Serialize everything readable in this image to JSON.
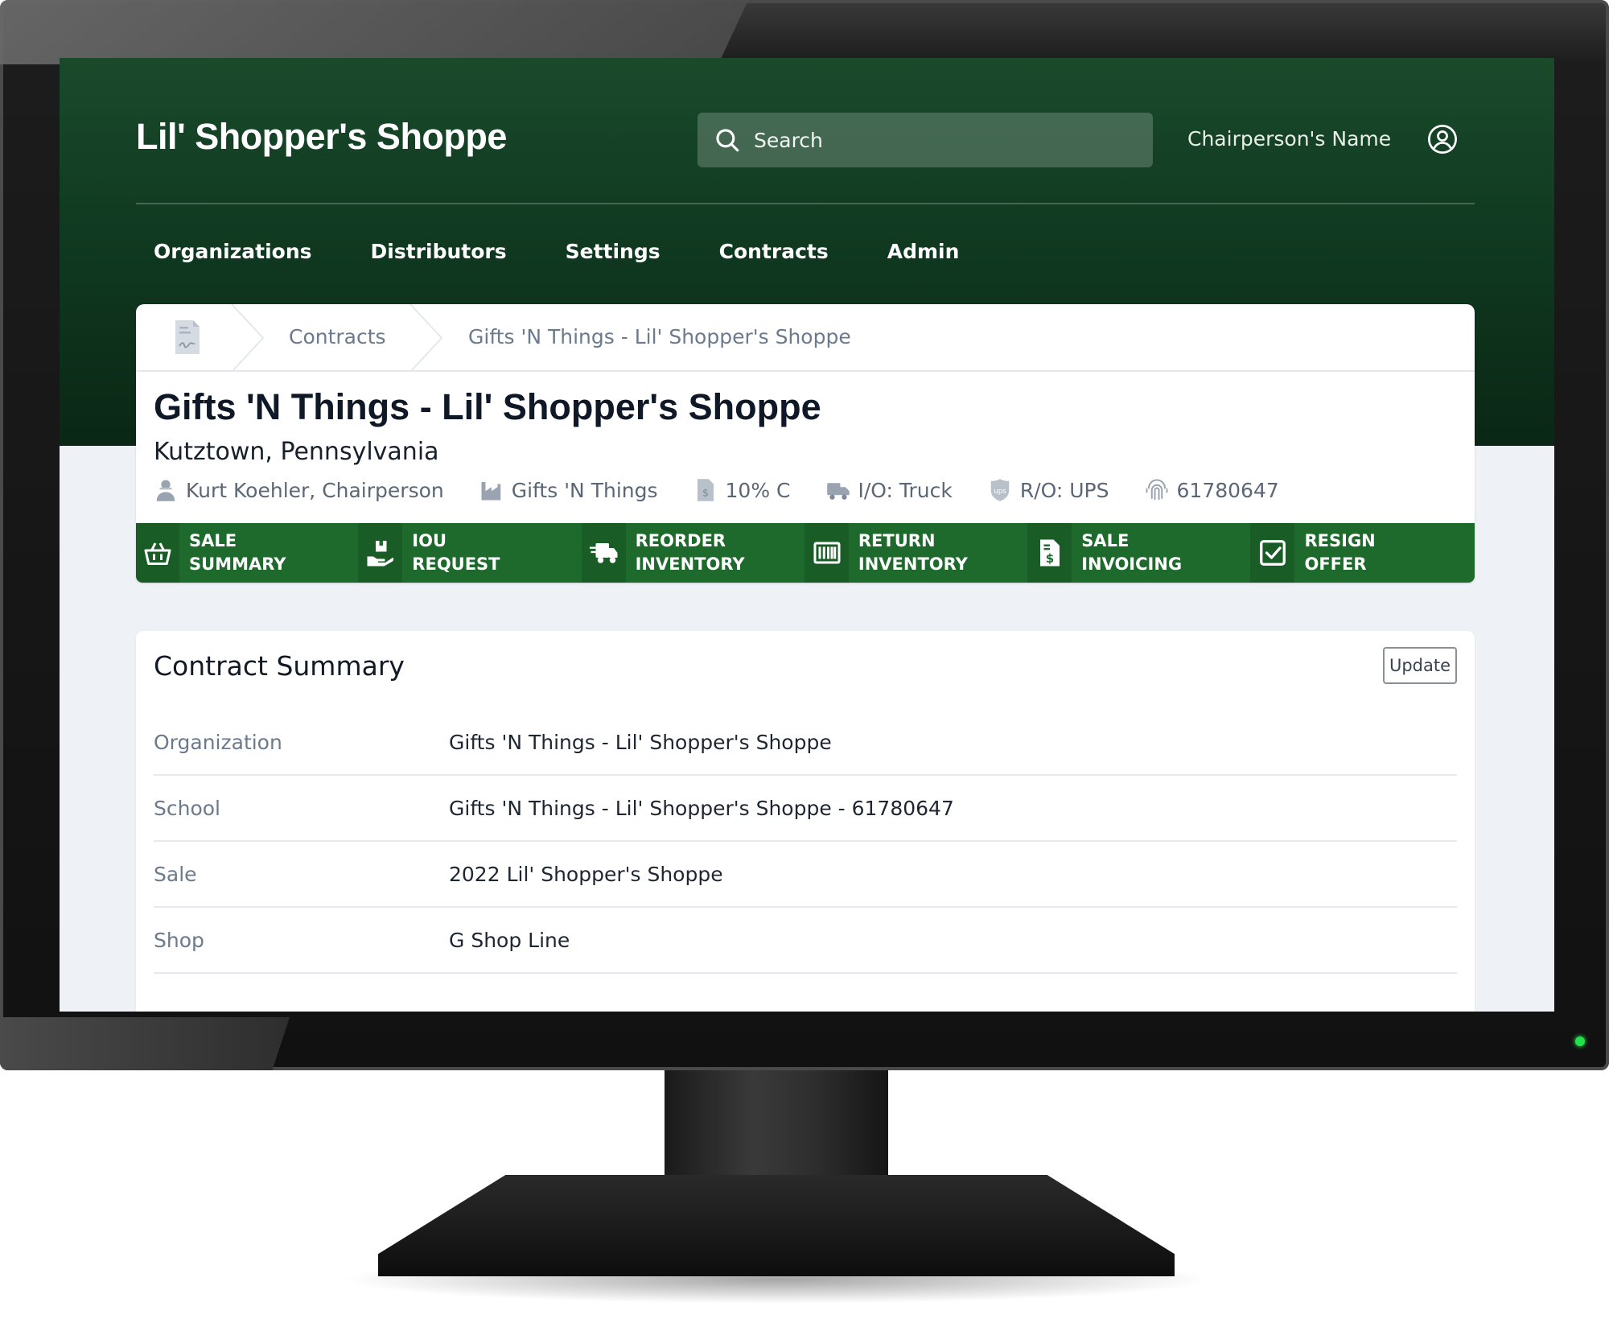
{
  "app": {
    "brand": "Lil' Shopper's Shoppe",
    "search_placeholder": "Search",
    "user_name": "Chairperson's Name"
  },
  "nav": [
    "Organizations",
    "Distributors",
    "Settings",
    "Contracts",
    "Admin"
  ],
  "breadcrumb": [
    "Contracts",
    "Gifts 'N Things - Lil' Shopper's Shoppe"
  ],
  "contract": {
    "title": "Gifts 'N Things - Lil' Shopper's Shoppe",
    "location": "Kutztown, Pennsylvania",
    "meta": [
      {
        "icon": "person-icon",
        "text": "Kurt Koehler, Chairperson"
      },
      {
        "icon": "factory-icon",
        "text": "Gifts 'N Things"
      },
      {
        "icon": "document-dollar-icon",
        "text": "10% C"
      },
      {
        "icon": "truck-icon",
        "text": "I/O: Truck"
      },
      {
        "icon": "ups-icon",
        "text": "R/O: UPS"
      },
      {
        "icon": "fingerprint-icon",
        "text": "61780647"
      }
    ]
  },
  "actions": [
    {
      "icon": "basket-icon",
      "line1": "SALE",
      "line2": "SUMMARY"
    },
    {
      "icon": "hand-box-icon",
      "line1": "IOU",
      "line2": "REQUEST"
    },
    {
      "icon": "shipping-truck-icon",
      "line1": "REORDER",
      "line2": "INVENTORY"
    },
    {
      "icon": "barcode-icon",
      "line1": "RETURN",
      "line2": "INVENTORY"
    },
    {
      "icon": "invoice-icon",
      "line1": "SALE",
      "line2": "INVOICING"
    },
    {
      "icon": "checkbox-icon",
      "line1": "RESIGN",
      "line2": "OFFER"
    }
  ],
  "summary": {
    "title": "Contract Summary",
    "update_label": "Update",
    "rows": [
      {
        "label": "Organization",
        "value": "Gifts 'N Things - Lil' Shopper's Shoppe"
      },
      {
        "label": "School",
        "value": "Gifts 'N Things - Lil' Shopper's Shoppe - 61780647"
      },
      {
        "label": "Sale",
        "value": "2022 Lil' Shopper's Shoppe"
      },
      {
        "label": "Shop",
        "value": "G Shop Line"
      }
    ]
  },
  "colors": {
    "header_green": "#103a21",
    "action_green": "#1d6a2c",
    "page_bg": "#eef2f6"
  }
}
